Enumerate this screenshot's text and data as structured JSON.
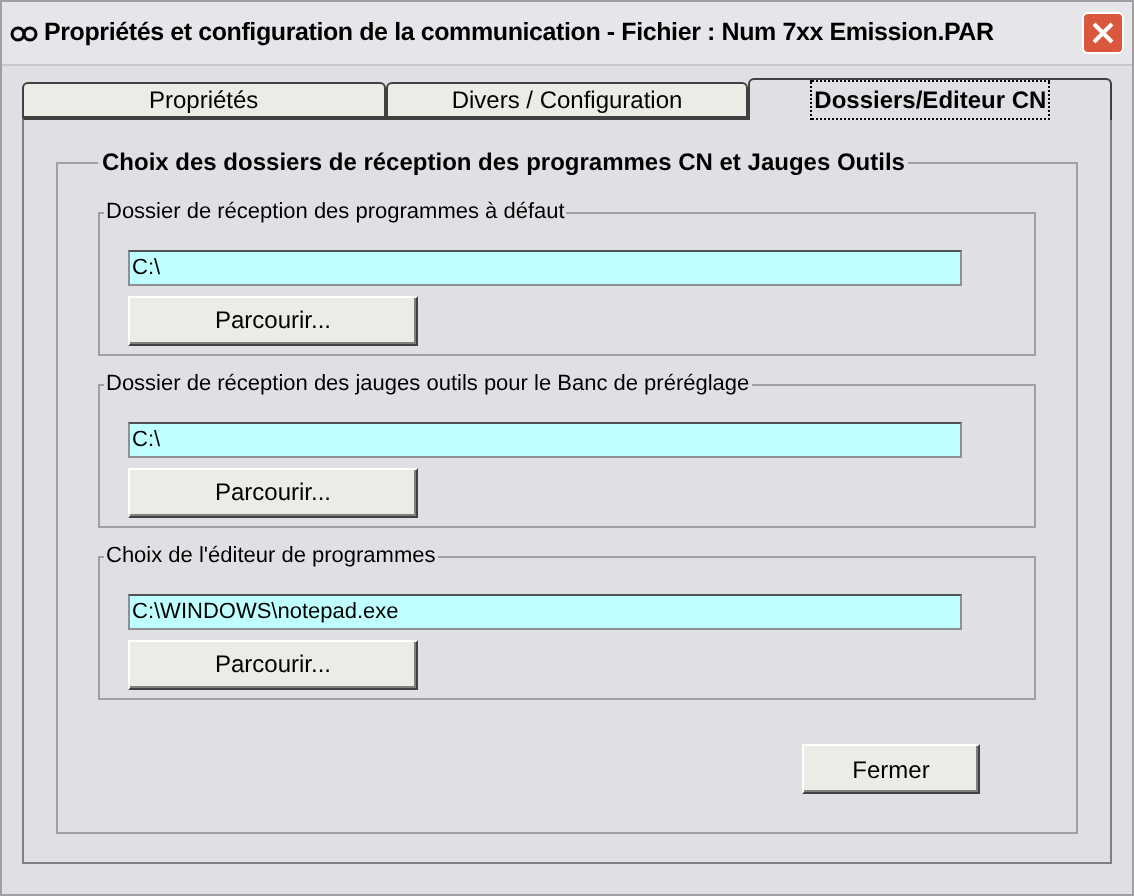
{
  "window": {
    "title": "Propriétés et configuration de la communication - Fichier : Num 7xx Emission.PAR"
  },
  "tabs": [
    {
      "label": "Propriétés",
      "selected": false
    },
    {
      "label": "Divers / Configuration",
      "selected": false
    },
    {
      "label": "Dossiers/Editeur CN",
      "selected": true
    }
  ],
  "group": {
    "title": "Choix des dossiers de réception des programmes CN et Jauges Outils",
    "sections": [
      {
        "title": "Dossier de réception des programmes à défaut",
        "value": "C:\\",
        "button": "Parcourir..."
      },
      {
        "title": "Dossier de réception des jauges outils pour le Banc de préréglage",
        "value": "C:\\",
        "button": "Parcourir..."
      },
      {
        "title": "Choix de l'éditeur de programmes",
        "value": "C:\\WINDOWS\\notepad.exe",
        "button": "Parcourir..."
      }
    ]
  },
  "close_button": "Fermer"
}
